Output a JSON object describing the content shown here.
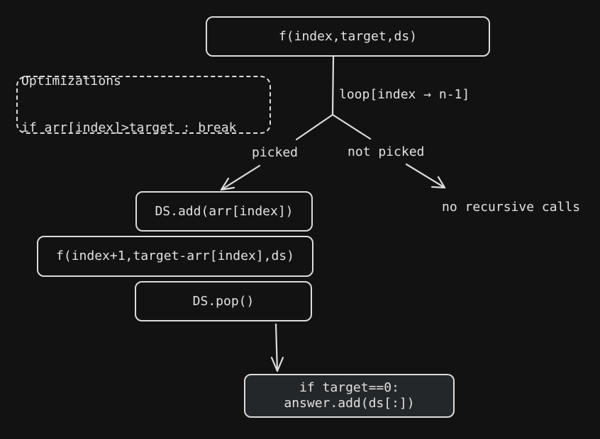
{
  "diagram": {
    "root_call": "f(index,target,ds)",
    "optimizations": {
      "title": "Optimizations",
      "rule": "if arr[index]>target : break"
    },
    "loop_label": "loop[index → n-1]",
    "picked_label": "picked",
    "not_picked_label": "not picked",
    "no_recursion_label": "no recursive calls",
    "steps": {
      "add": "DS.add(arr[index])",
      "recurse": "f(index+1,target-arr[index],ds)",
      "pop": "DS.pop()"
    },
    "base_case": {
      "line1": "if target==0:",
      "line2": "answer.add(ds[:])"
    },
    "colors": {
      "background": "#121212",
      "stroke": "#dcdcdc",
      "final_fill": "#24272a"
    }
  }
}
